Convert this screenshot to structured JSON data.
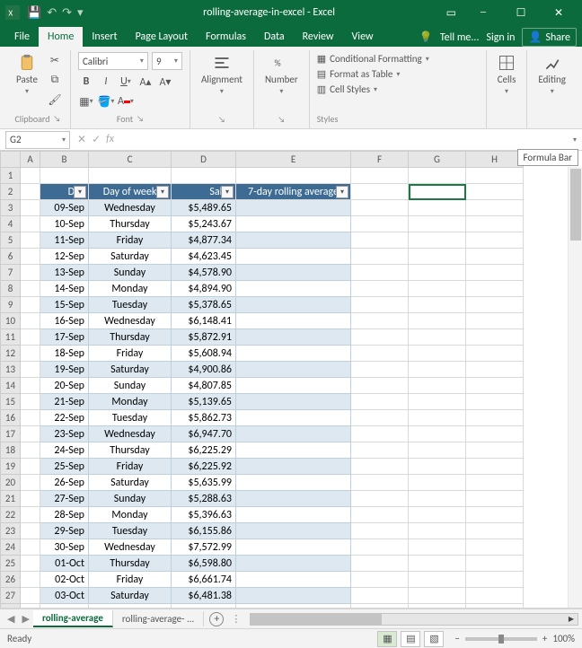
{
  "app": {
    "title": "rolling-average-in-excel - Excel"
  },
  "tabs": {
    "file": "File",
    "home": "Home",
    "insert": "Insert",
    "pageLayout": "Page Layout",
    "formulas": "Formulas",
    "data": "Data",
    "review": "Review",
    "view": "View",
    "tellMe": "Tell me...",
    "signIn": "Sign in",
    "share": "Share"
  },
  "ribbon": {
    "clipboard": {
      "paste": "Paste",
      "label": "Clipboard"
    },
    "font": {
      "name": "Calibri",
      "size": "9",
      "label": "Font"
    },
    "alignment": {
      "label": "Alignment",
      "btn": "Alignment"
    },
    "number": {
      "label": "Number",
      "btn": "Number"
    },
    "styles": {
      "condFmt": "Conditional Formatting",
      "table": "Format as Table",
      "cellStyles": "Cell Styles",
      "label": "Styles"
    },
    "cells": {
      "btn": "Cells"
    },
    "editing": {
      "btn": "Editing"
    }
  },
  "formulaBar": {
    "nameBox": "G2",
    "fx": "fx",
    "tooltip": "Formula Bar"
  },
  "columns": [
    "A",
    "B",
    "C",
    "D",
    "E",
    "F",
    "G",
    "H"
  ],
  "headers": {
    "day": "Day",
    "dow": "Day of week",
    "sales": "Sales",
    "rolling": "7-day rolling average"
  },
  "rows": [
    {
      "r": 3,
      "day": "09-Sep",
      "dow": "Wednesday",
      "sales": "$5,489.65"
    },
    {
      "r": 4,
      "day": "10-Sep",
      "dow": "Thursday",
      "sales": "$5,243.67"
    },
    {
      "r": 5,
      "day": "11-Sep",
      "dow": "Friday",
      "sales": "$4,877.34"
    },
    {
      "r": 6,
      "day": "12-Sep",
      "dow": "Saturday",
      "sales": "$4,623.45"
    },
    {
      "r": 7,
      "day": "13-Sep",
      "dow": "Sunday",
      "sales": "$4,578.90"
    },
    {
      "r": 8,
      "day": "14-Sep",
      "dow": "Monday",
      "sales": "$4,894.90"
    },
    {
      "r": 9,
      "day": "15-Sep",
      "dow": "Tuesday",
      "sales": "$5,378.65"
    },
    {
      "r": 10,
      "day": "16-Sep",
      "dow": "Wednesday",
      "sales": "$6,148.41"
    },
    {
      "r": 11,
      "day": "17-Sep",
      "dow": "Thursday",
      "sales": "$5,872.91"
    },
    {
      "r": 12,
      "day": "18-Sep",
      "dow": "Friday",
      "sales": "$5,608.94"
    },
    {
      "r": 13,
      "day": "19-Sep",
      "dow": "Saturday",
      "sales": "$4,900.86"
    },
    {
      "r": 14,
      "day": "20-Sep",
      "dow": "Sunday",
      "sales": "$4,807.85"
    },
    {
      "r": 15,
      "day": "21-Sep",
      "dow": "Monday",
      "sales": "$5,139.65"
    },
    {
      "r": 16,
      "day": "22-Sep",
      "dow": "Tuesday",
      "sales": "$5,862.73"
    },
    {
      "r": 17,
      "day": "23-Sep",
      "dow": "Wednesday",
      "sales": "$6,947.70"
    },
    {
      "r": 18,
      "day": "24-Sep",
      "dow": "Thursday",
      "sales": "$6,225.29"
    },
    {
      "r": 19,
      "day": "25-Sep",
      "dow": "Friday",
      "sales": "$6,225.92"
    },
    {
      "r": 20,
      "day": "26-Sep",
      "dow": "Saturday",
      "sales": "$5,635.99"
    },
    {
      "r": 21,
      "day": "27-Sep",
      "dow": "Sunday",
      "sales": "$5,288.63"
    },
    {
      "r": 22,
      "day": "28-Sep",
      "dow": "Monday",
      "sales": "$5,396.63"
    },
    {
      "r": 23,
      "day": "29-Sep",
      "dow": "Tuesday",
      "sales": "$6,155.86"
    },
    {
      "r": 24,
      "day": "30-Sep",
      "dow": "Wednesday",
      "sales": "$7,572.99"
    },
    {
      "r": 25,
      "day": "01-Oct",
      "dow": "Thursday",
      "sales": "$6,598.80"
    },
    {
      "r": 26,
      "day": "02-Oct",
      "dow": "Friday",
      "sales": "$6,661.74"
    },
    {
      "r": 27,
      "day": "03-Oct",
      "dow": "Saturday",
      "sales": "$6,481.38"
    }
  ],
  "sheetTabs": {
    "active": "rolling-average",
    "other": "rolling-average-",
    "ellipsis": "..."
  },
  "status": {
    "ready": "Ready",
    "zoom": "100%"
  },
  "chart_data": {
    "type": "table",
    "title": "rolling-average-in-excel",
    "columns": [
      "Day",
      "Day of week",
      "Sales",
      "7-day rolling average"
    ],
    "categories": [
      "09-Sep",
      "10-Sep",
      "11-Sep",
      "12-Sep",
      "13-Sep",
      "14-Sep",
      "15-Sep",
      "16-Sep",
      "17-Sep",
      "18-Sep",
      "19-Sep",
      "20-Sep",
      "21-Sep",
      "22-Sep",
      "23-Sep",
      "24-Sep",
      "25-Sep",
      "26-Sep",
      "27-Sep",
      "28-Sep",
      "29-Sep",
      "30-Sep",
      "01-Oct",
      "02-Oct",
      "03-Oct"
    ],
    "series": [
      {
        "name": "Sales",
        "values": [
          5489.65,
          5243.67,
          4877.34,
          4623.45,
          4578.9,
          4894.9,
          5378.65,
          6148.41,
          5872.91,
          5608.94,
          4900.86,
          4807.85,
          5139.65,
          5862.73,
          6947.7,
          6225.29,
          6225.92,
          5635.99,
          5288.63,
          5396.63,
          6155.86,
          7572.99,
          6598.8,
          6661.74,
          6481.38
        ]
      }
    ]
  }
}
